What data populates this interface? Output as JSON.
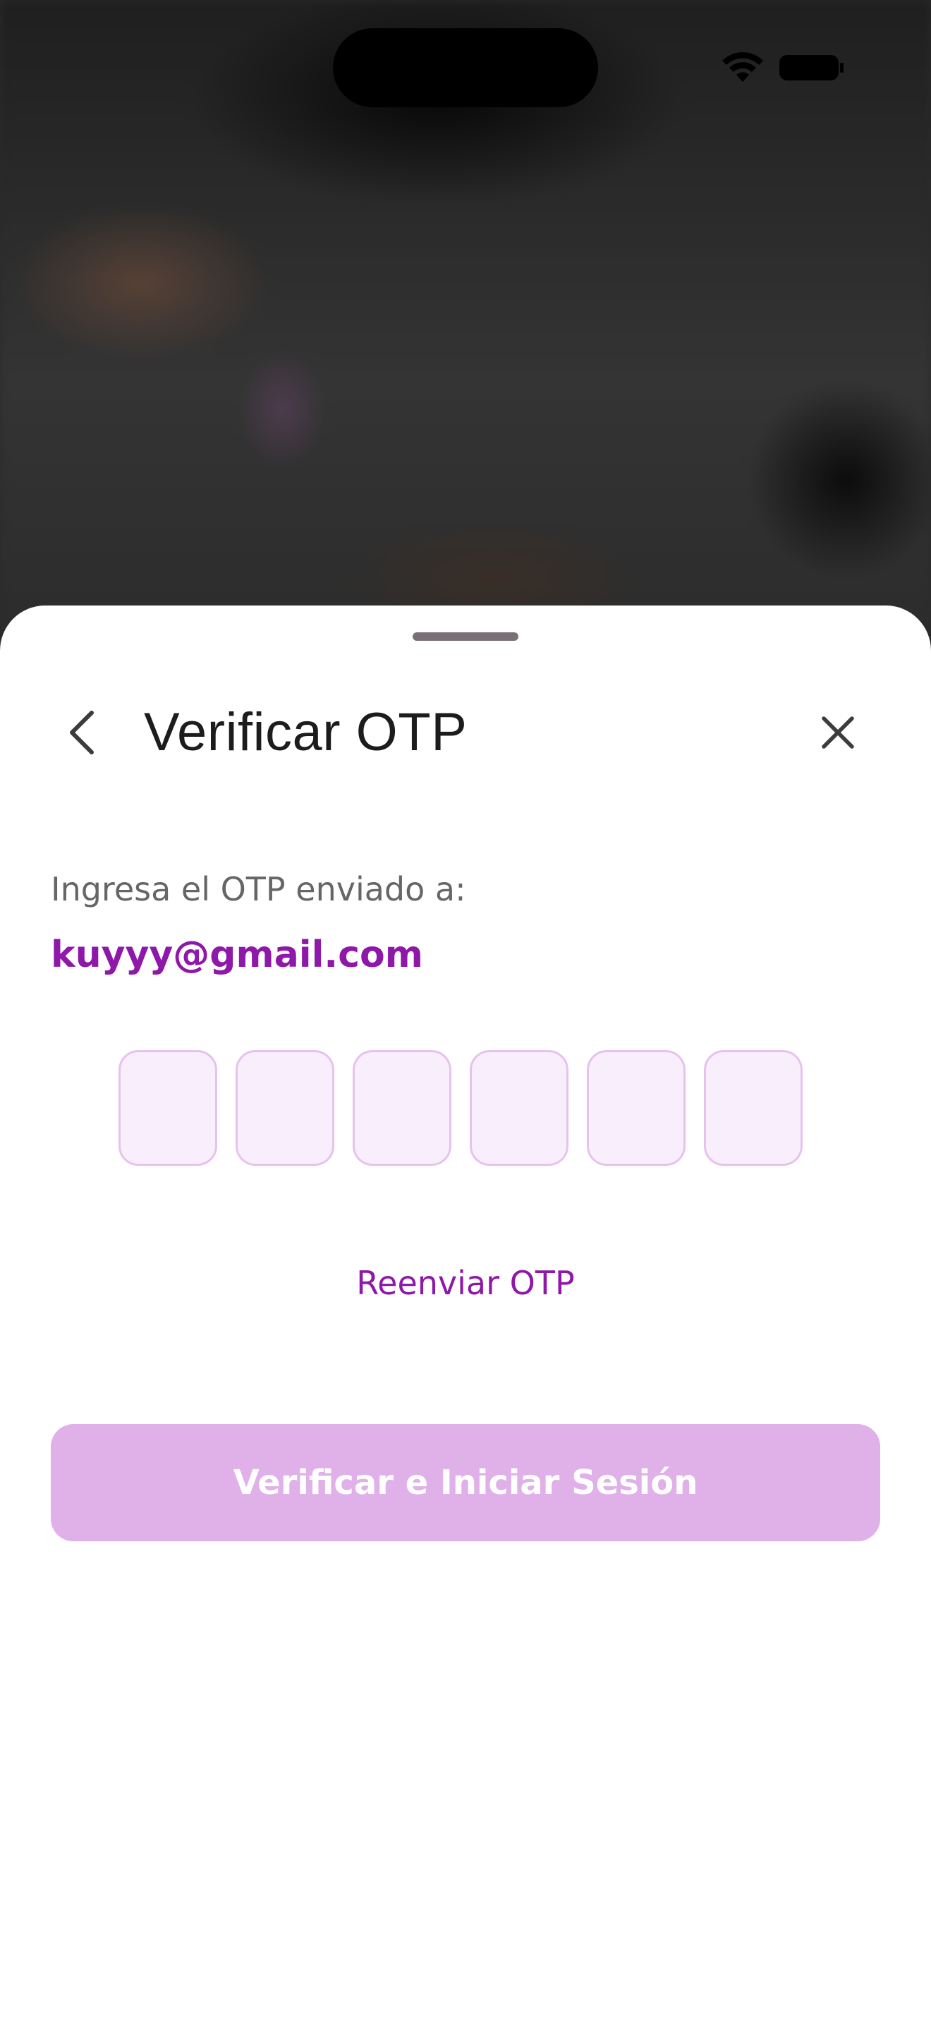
{
  "header": {
    "title": "Verificar OTP",
    "back_icon": "chevron-left-icon",
    "close_icon": "close-icon"
  },
  "body": {
    "instruction": "Ingresa el OTP enviado a:",
    "email": "kuyyy@gmail.com"
  },
  "otp": {
    "digits": [
      "",
      "",
      "",
      "",
      "",
      ""
    ]
  },
  "actions": {
    "resend_label": "Reenviar OTP",
    "verify_label": "Verificar e Iniciar Sesión",
    "verify_enabled": false
  },
  "colors": {
    "accent": "#8e18a8",
    "button_disabled": "#dfb1e8",
    "otp_border": "#e7c2ef",
    "otp_fill": "#f8eefc"
  }
}
